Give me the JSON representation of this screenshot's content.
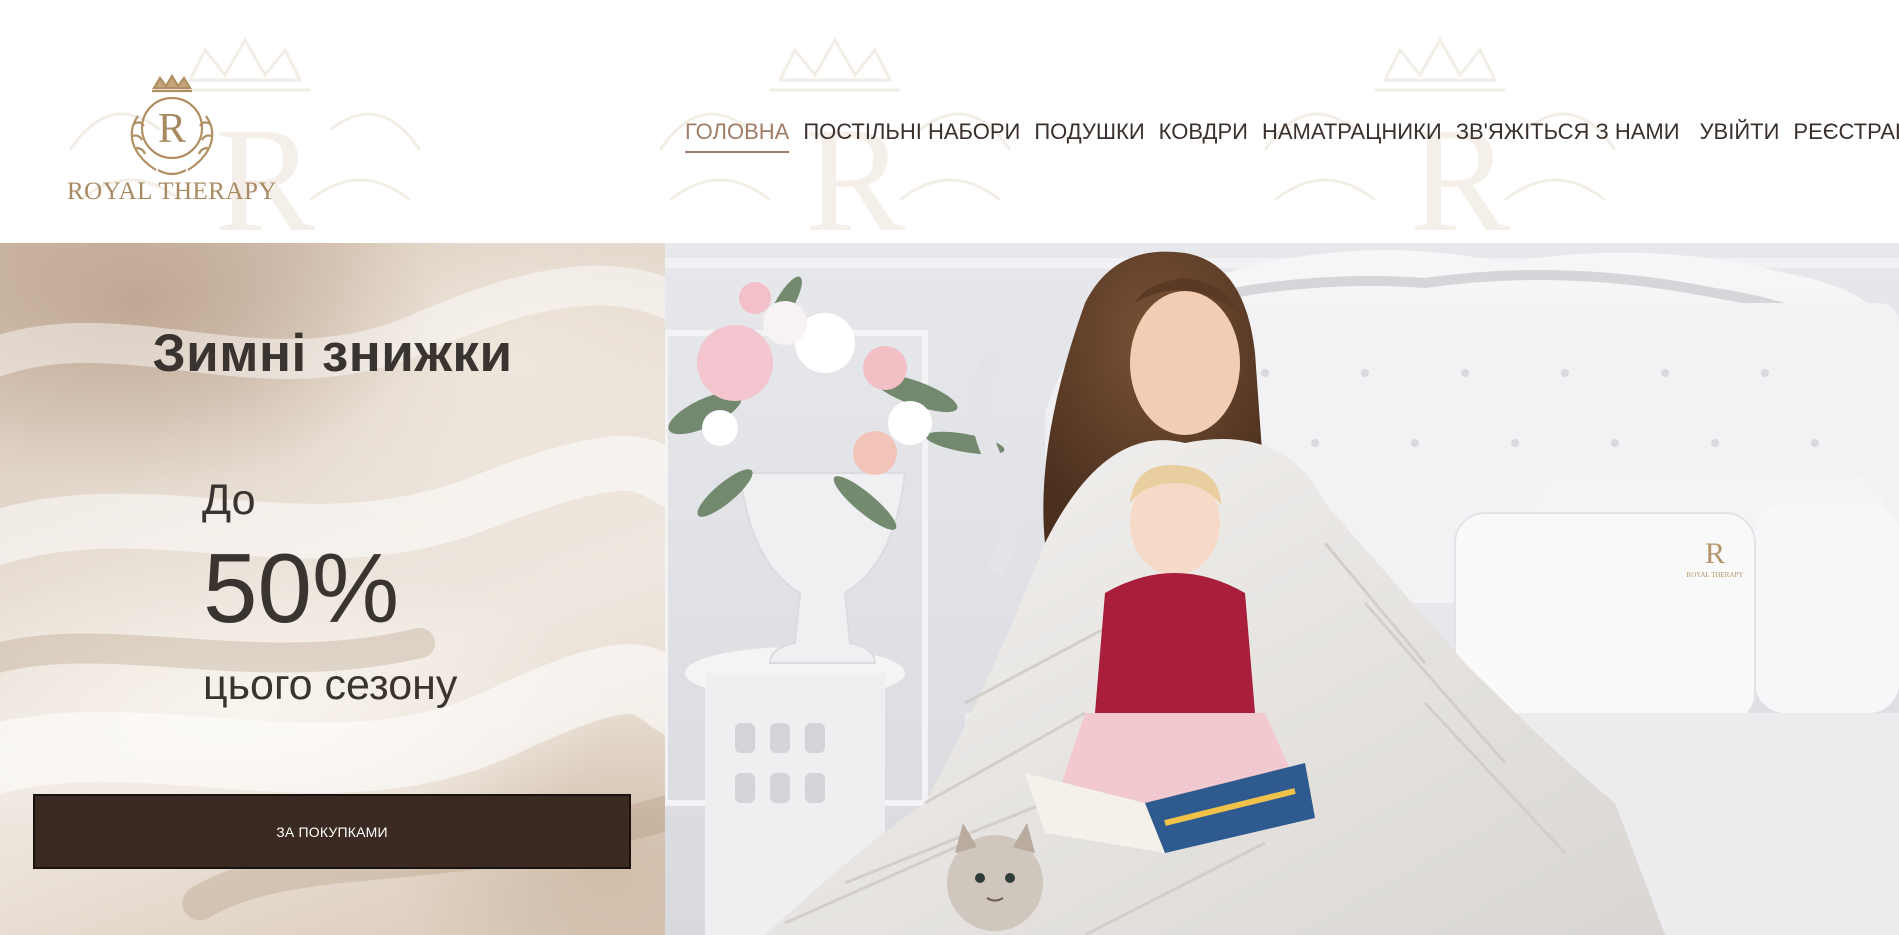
{
  "header": {
    "logo": {
      "monogram": "R",
      "brand_text": "ROYAL THERAPY",
      "color": "#a88a62"
    },
    "nav": {
      "items": [
        {
          "label": "ГОЛОВНА",
          "active": true
        },
        {
          "label": "ПОСТІЛЬНІ НАБОРИ",
          "active": false
        },
        {
          "label": "ПОДУШКИ",
          "active": false
        },
        {
          "label": "КОВДРИ",
          "active": false
        },
        {
          "label": "НАМАТРАЦНИКИ",
          "active": false
        },
        {
          "label": "ЗВ'ЯЖІТЬСЯ З НАМИ",
          "active": false
        },
        {
          "label": "УВІЙТИ",
          "active": false
        },
        {
          "label": "РЕЄСТРАЦІЯ",
          "active": false
        }
      ],
      "active_color": "#a27d66"
    }
  },
  "hero": {
    "title": "Зимні знижки",
    "discount_prefix": "До",
    "discount_value": "50%",
    "discount_suffix": "цього сезону",
    "cta_label": "ЗА ПОКУПКАМИ",
    "cta_color": "#3b2a22",
    "pillow_brand": "ROYAL THERAPY",
    "pillow_monogram": "R"
  }
}
